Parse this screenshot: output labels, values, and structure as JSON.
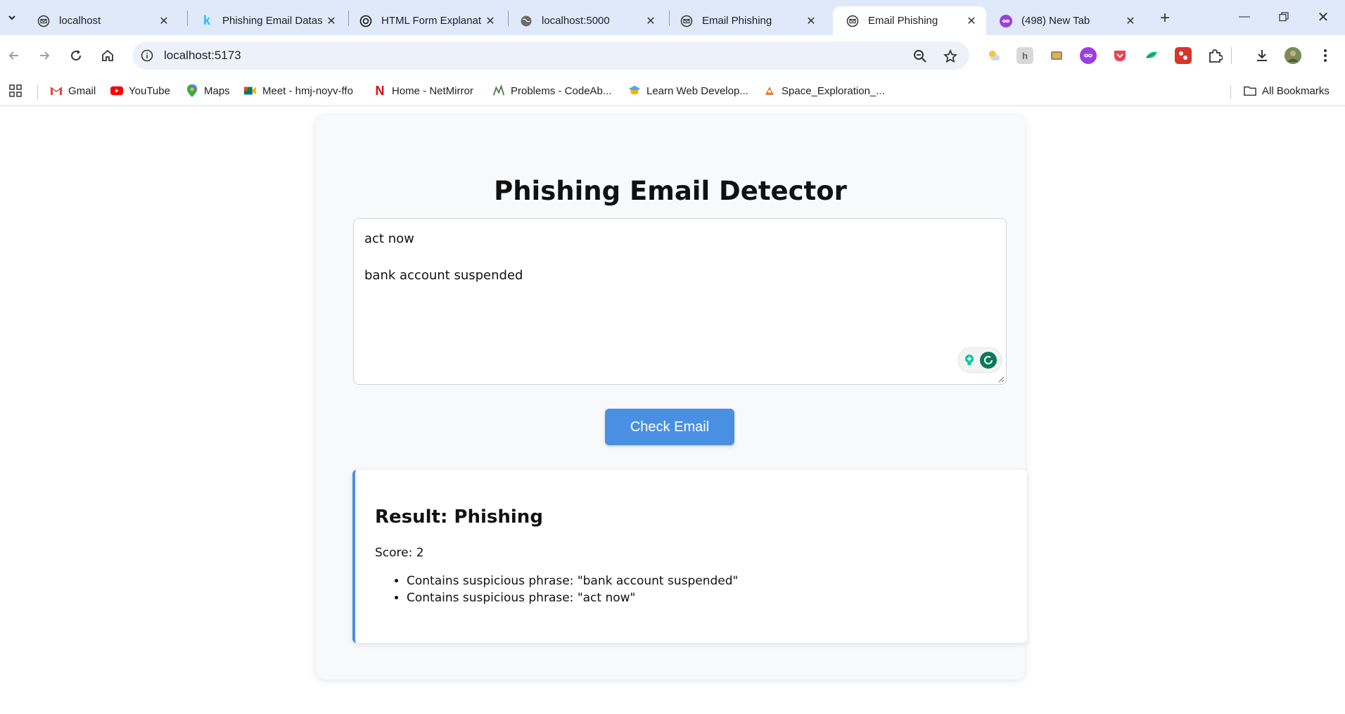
{
  "browser": {
    "tabs": [
      {
        "label": "localhost",
        "icon": "globe-mail-icon",
        "active": false
      },
      {
        "label": "Phishing Email Datas",
        "icon": "kaggle-icon",
        "active": false
      },
      {
        "label": "HTML Form Explanat",
        "icon": "chatgpt-icon",
        "active": false
      },
      {
        "label": "localhost:5000",
        "icon": "globe-icon",
        "active": false
      },
      {
        "label": "Email Phishing",
        "icon": "globe-mail-icon",
        "active": false
      },
      {
        "label": "Email Phishing",
        "icon": "globe-mail-icon",
        "active": true
      },
      {
        "label": "(498) New Tab",
        "icon": "infinity-icon",
        "active": false
      }
    ],
    "address": "localhost:5173"
  },
  "bookmarks": {
    "items": [
      {
        "label": "Gmail",
        "icon": "gmail-icon"
      },
      {
        "label": "YouTube",
        "icon": "youtube-icon"
      },
      {
        "label": "Maps",
        "icon": "maps-icon"
      },
      {
        "label": "Meet - hmj-noyv-ffo",
        "icon": "meet-icon"
      },
      {
        "label": "Home - NetMirror",
        "icon": "netmirror-icon"
      },
      {
        "label": "Problems - CodeAb...",
        "icon": "codeab-icon"
      },
      {
        "label": "Learn Web Develop...",
        "icon": "learn-icon"
      },
      {
        "label": "Space_Exploration_...",
        "icon": "space-icon"
      }
    ],
    "all_label": "All Bookmarks"
  },
  "page": {
    "title": "Phishing Email Detector",
    "email_text": "act now\n\nbank account suspended",
    "check_button": "Check Email",
    "result": {
      "heading": "Result: Phishing",
      "score": "Score: 2",
      "reasons": [
        "Contains suspicious phrase: \"bank account suspended\"",
        "Contains suspicious phrase: \"act now\""
      ]
    }
  },
  "colors": {
    "accent": "#4a90e2",
    "tab_strip": "#dfe9f9",
    "omnibox": "#edf2fa"
  }
}
